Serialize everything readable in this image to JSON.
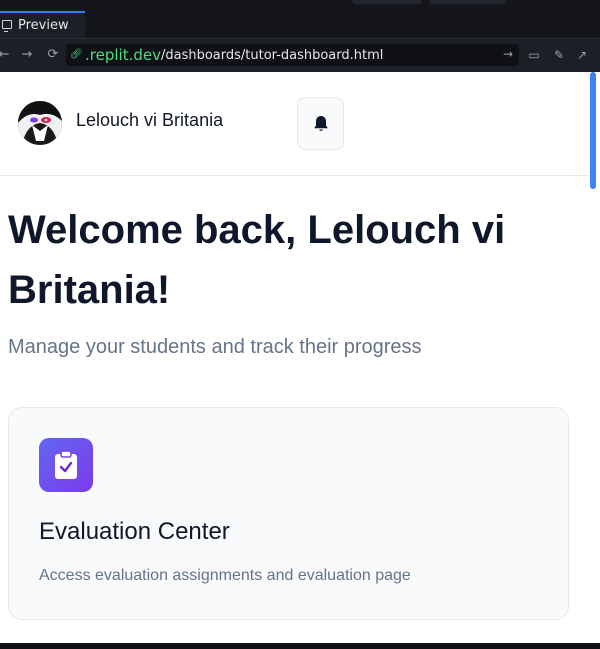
{
  "browser": {
    "tab_label": "Preview",
    "url_host": ".replit.dev",
    "url_path": "/dashboards/tutor-dashboard.html"
  },
  "header": {
    "user_name": "Lelouch vi Britania"
  },
  "main": {
    "welcome_line": "Welcome back, Lelouch vi Britania!",
    "subtitle": "Manage your students and track their progress"
  },
  "cards": [
    {
      "title": "Evaluation Center",
      "description": "Access evaluation assignments and evaluation page"
    }
  ],
  "colors": {
    "accent": "#3b82f6",
    "card_icon_start": "#6366f1",
    "card_icon_end": "#7c3aed",
    "url_host": "#4ade80"
  }
}
